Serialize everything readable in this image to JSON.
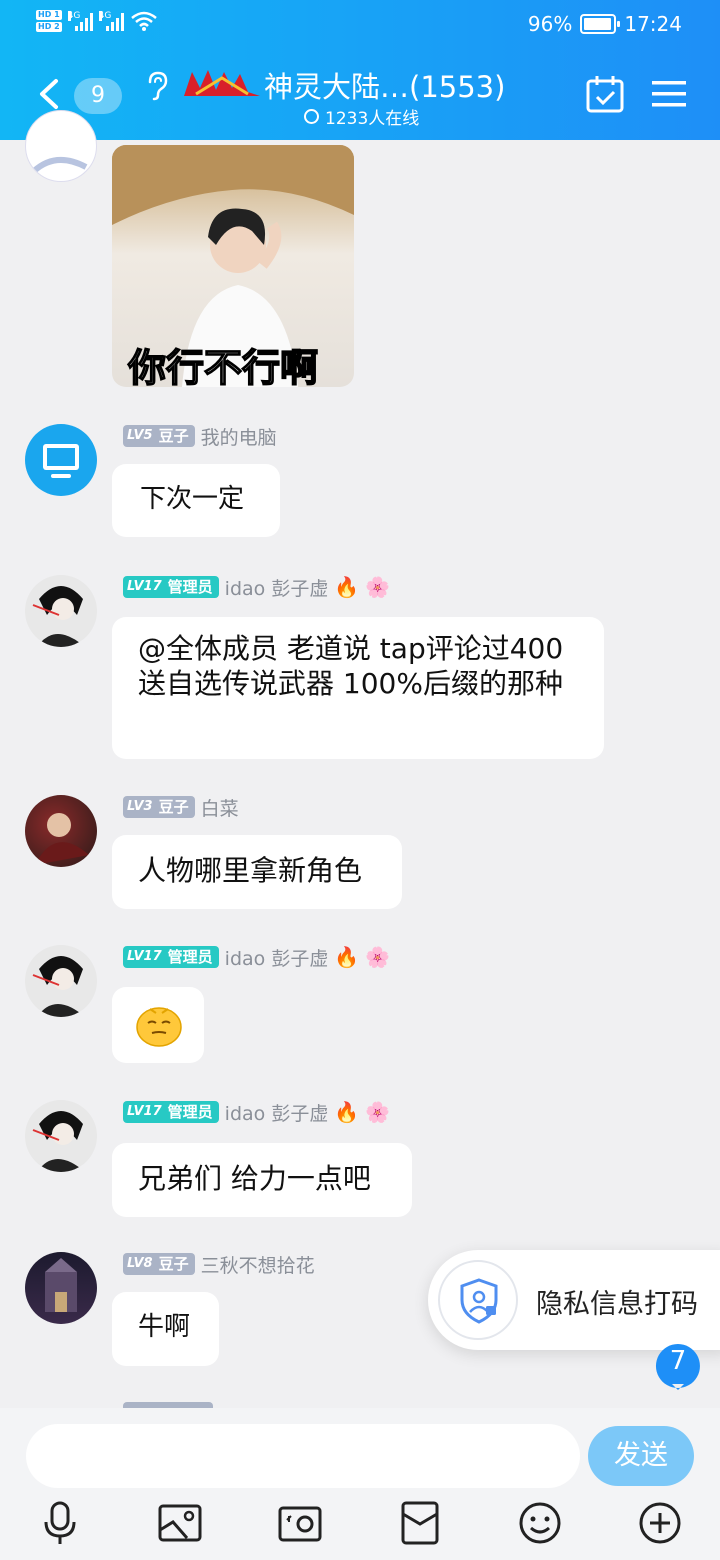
{
  "status_bar": {
    "net1": "4G",
    "net2": "4G",
    "battery": "96%",
    "time": "17:24"
  },
  "header": {
    "unread_count": "9",
    "title": "神灵大陆…(1553)",
    "online": "1233人在线"
  },
  "messages": [
    {
      "kind": "image",
      "caption": "你行不行啊"
    },
    {
      "level": "LV5",
      "role": "豆子",
      "name": "我的电脑",
      "text": "下次一定"
    },
    {
      "level": "LV17",
      "role": "管理员",
      "name": "idao 彭子虚",
      "text": "@全体成员  老道说 tap评论过400 送自选传说武器 100%后缀的那种"
    },
    {
      "level": "LV3",
      "role": "豆子",
      "name": "白菜",
      "text": "人物哪里拿新角色"
    },
    {
      "level": "LV17",
      "role": "管理员",
      "name": "idao 彭子虚",
      "sticker": "smirk-face-icon"
    },
    {
      "level": "LV17",
      "role": "管理员",
      "name": "idao 彭子虚",
      "text": "兄弟们 给力一点吧"
    },
    {
      "level": "LV8",
      "role": "豆子",
      "name": "三秋不想拾花",
      "text": "牛啊"
    }
  ],
  "privacy_popup": {
    "label": "隐私信息打码"
  },
  "unread_bubble": "7",
  "input": {
    "send_label": "发送"
  },
  "toolbar_icons": [
    "microphone-icon",
    "picture-icon",
    "camera-icon",
    "red-packet-icon",
    "emoji-icon",
    "plus-icon"
  ],
  "colors": {
    "header_start": "#12b6f5",
    "header_end": "#1e8ff7",
    "admin_tag": "#27c9c4",
    "member_tag": "#aab3c6",
    "send_button": "#7cc8f8"
  }
}
